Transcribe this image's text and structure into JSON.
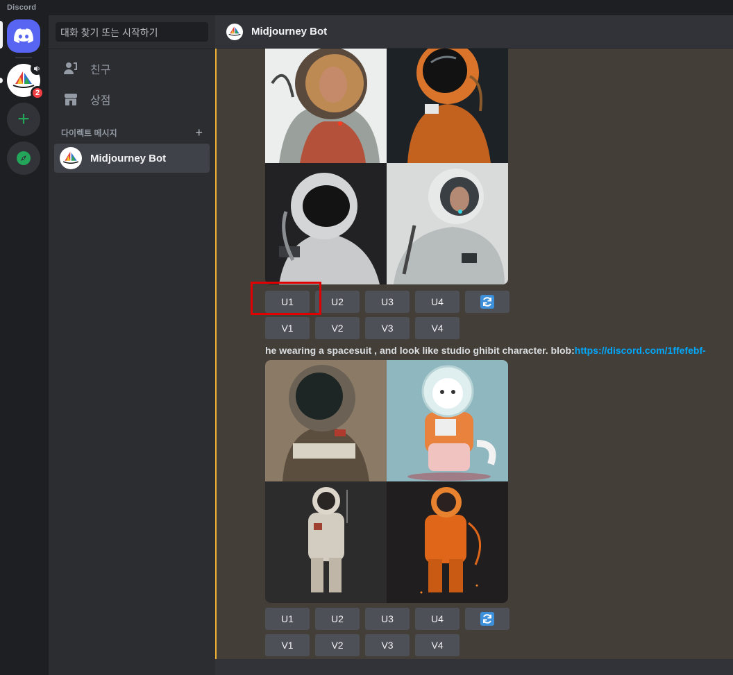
{
  "app": {
    "brand": "Discord"
  },
  "servers": {
    "mj_badge": "2",
    "add_symbol": "+"
  },
  "dm_panel": {
    "search_placeholder": "대화 찾기 또는 시작하기",
    "nav": [
      {
        "label": "친구",
        "icon": "friends-icon"
      },
      {
        "label": "상점",
        "icon": "shop-icon"
      }
    ],
    "section_title": "다이렉트 메시지",
    "section_plus": "+",
    "dms": [
      {
        "name": "Midjourney Bot"
      }
    ]
  },
  "chat": {
    "header_title": "Midjourney Bot",
    "messages": [
      {
        "images": [
          "astronaut-realistic-1",
          "astronaut-orange-2",
          "astronaut-helmet-3",
          "astronaut-white-4"
        ],
        "upscale_buttons": [
          "U1",
          "U2",
          "U3",
          "U4"
        ],
        "variation_buttons": [
          "V1",
          "V2",
          "V3",
          "V4"
        ],
        "highlighted": "U1"
      },
      {
        "prompt_text": "he wearing a spacesuit , and look like studio ghibit character. blob:",
        "prompt_link": "https://discord.com/1ffefebf-",
        "images": [
          "astronaut-brown-1",
          "cat-astronaut-2",
          "astronaut-white-3",
          "astronaut-orange-4"
        ],
        "upscale_buttons": [
          "U1",
          "U2",
          "U3",
          "U4"
        ],
        "variation_buttons": [
          "V1",
          "V2",
          "V3",
          "V4"
        ]
      }
    ]
  },
  "colors": {
    "accent": "#5865f2",
    "highlight": "#e00000",
    "link": "#00a8fc",
    "mention_bar": "#f0b232",
    "feed_bg": "#433e38"
  }
}
